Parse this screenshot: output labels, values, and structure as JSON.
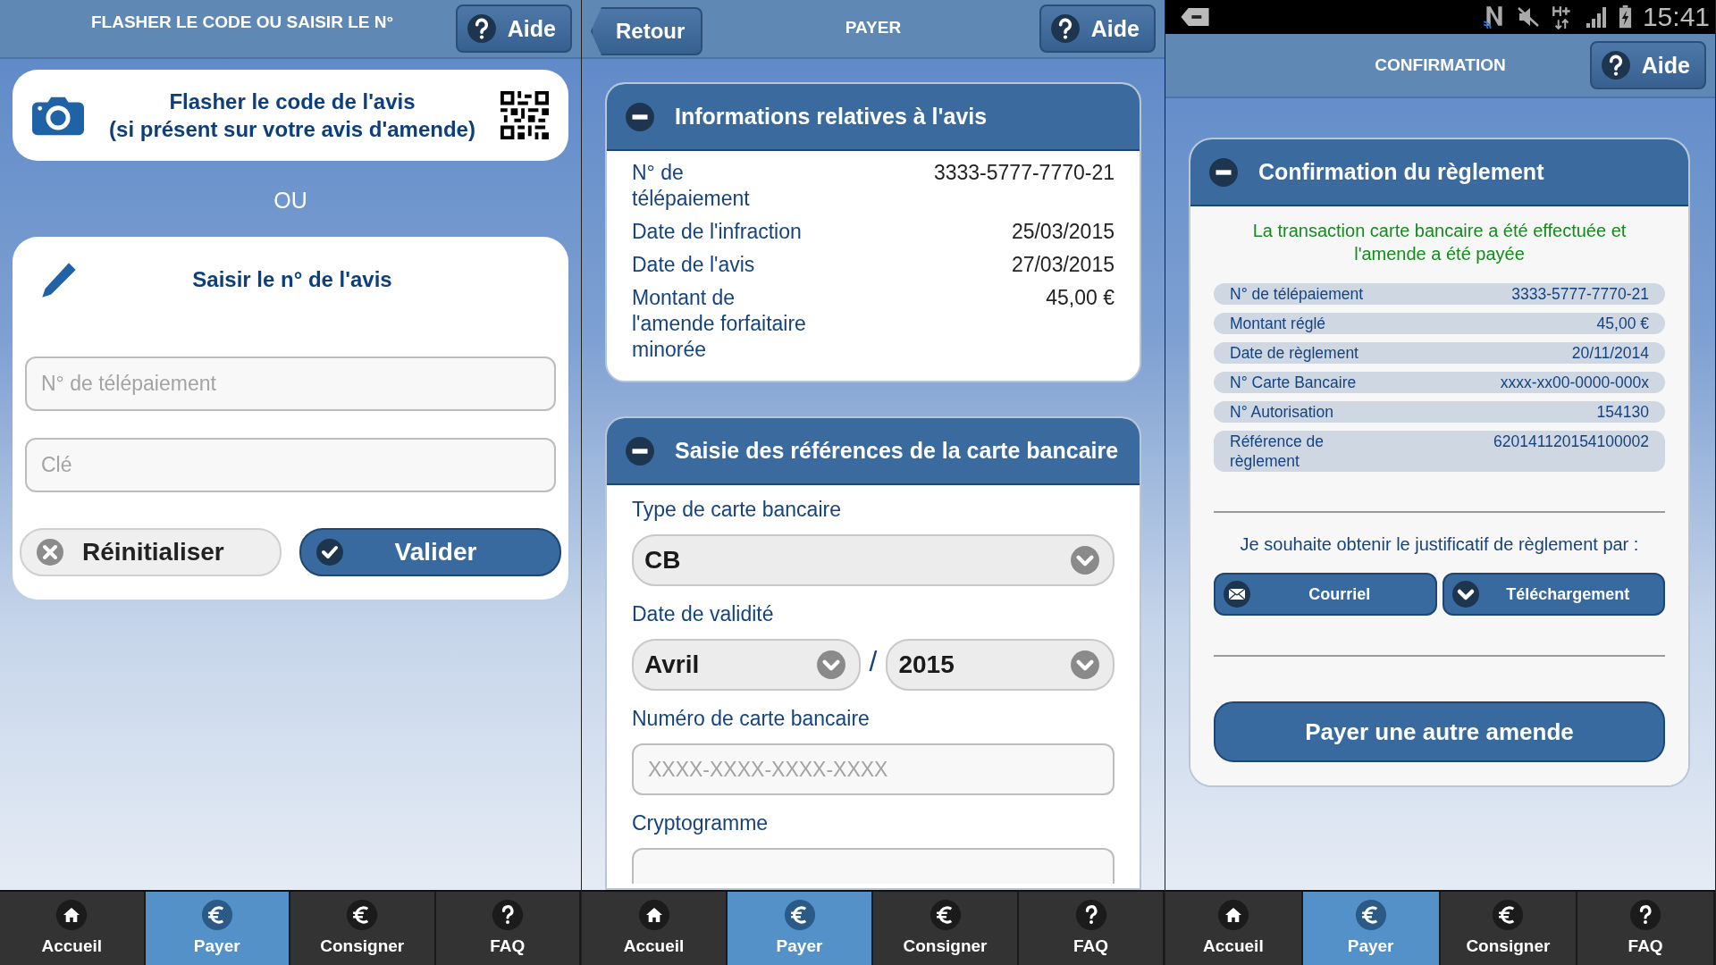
{
  "scan_screen": {
    "title": "FLASHER LE CODE OU SAISIR LE N°",
    "help_button": "Aide",
    "scan_card": {
      "title": "Flasher le code de l'avis",
      "subtitle": "(si présent sur votre avis d'amende)"
    },
    "separator": "OU",
    "entry_card": {
      "title": "Saisir le n° de l'avis",
      "fields": [
        {
          "placeholder": "N° de télépaiement"
        },
        {
          "placeholder": "Clé"
        }
      ],
      "reset_button": "Réinitialiser",
      "submit_button": "Valider"
    },
    "nav": [
      {
        "label": "Accueil",
        "kind": "home",
        "selected": false
      },
      {
        "label": "Payer",
        "kind": "euro",
        "selected": true
      },
      {
        "label": "Consigner",
        "kind": "euro",
        "selected": false
      },
      {
        "label": "FAQ",
        "kind": "help",
        "selected": false
      }
    ]
  },
  "payment_screen": {
    "back_button": "Retour",
    "title": "PAYER",
    "help_button": "Aide",
    "notice_section": {
      "title": "Informations relatives à l'avis",
      "expanded": true,
      "rows": [
        {
          "label": "N° de télépaiement",
          "value": "3333-5777-7770-21"
        },
        {
          "label": "Date de l'infraction",
          "value": "25/03/2015"
        },
        {
          "label": "Date de l'avis",
          "value": "27/03/2015"
        },
        {
          "label": "Montant de l'amende forfaitaire minorée",
          "value": "45,00 €"
        }
      ]
    },
    "card_section": {
      "title": "Saisie des références de la carte bancaire",
      "expanded": true,
      "card_type_label": "Type de carte bancaire",
      "card_type": "CB",
      "validity_label": "Date de validité",
      "month": "Avril",
      "date_separator": "/",
      "year": "2015",
      "number_label": "Numéro de carte bancaire",
      "number_placeholder": "XXXX-XXXX-XXXX-XXXX",
      "cvv_label": "Cryptogramme"
    },
    "nav": [
      {
        "label": "Accueil",
        "kind": "home",
        "selected": false
      },
      {
        "label": "Payer",
        "kind": "euro",
        "selected": true
      },
      {
        "label": "Consigner",
        "kind": "euro",
        "selected": false
      },
      {
        "label": "FAQ",
        "kind": "help",
        "selected": false
      }
    ]
  },
  "confirmation_screen": {
    "status_bar": {
      "time": "15:41"
    },
    "title": "CONFIRMATION",
    "help_button": "Aide",
    "section": {
      "title": "Confirmation du règlement",
      "expanded": true,
      "message": "La transaction carte bancaire a été effectuée et l'amende a été payée",
      "rows": [
        {
          "label": "N° de télépaiement",
          "value": "3333-5777-7770-21"
        },
        {
          "label": "Montant réglé",
          "value": "45,00 €"
        },
        {
          "label": "Date de règlement",
          "value": "20/11/2014"
        },
        {
          "label": "N° Carte Bancaire",
          "value": "xxxx-xx00-0000-000x"
        },
        {
          "label": "N° Autorisation",
          "value": "154130"
        },
        {
          "label": "Référence de règlement",
          "value": "620141120154100002"
        }
      ],
      "prompt": "Je souhaite obtenir le justificatif de règlement par :",
      "receipt_buttons": [
        {
          "label": "Courriel",
          "kind": "mail"
        },
        {
          "label": "Téléchargement",
          "kind": "download"
        }
      ],
      "other_button": "Payer une autre amende"
    },
    "nav": [
      {
        "label": "Accueil",
        "kind": "home",
        "selected": false
      },
      {
        "label": "Payer",
        "kind": "euro",
        "selected": true
      },
      {
        "label": "Consigner",
        "kind": "euro",
        "selected": false
      },
      {
        "label": "FAQ",
        "kind": "help",
        "selected": false
      }
    ]
  }
}
